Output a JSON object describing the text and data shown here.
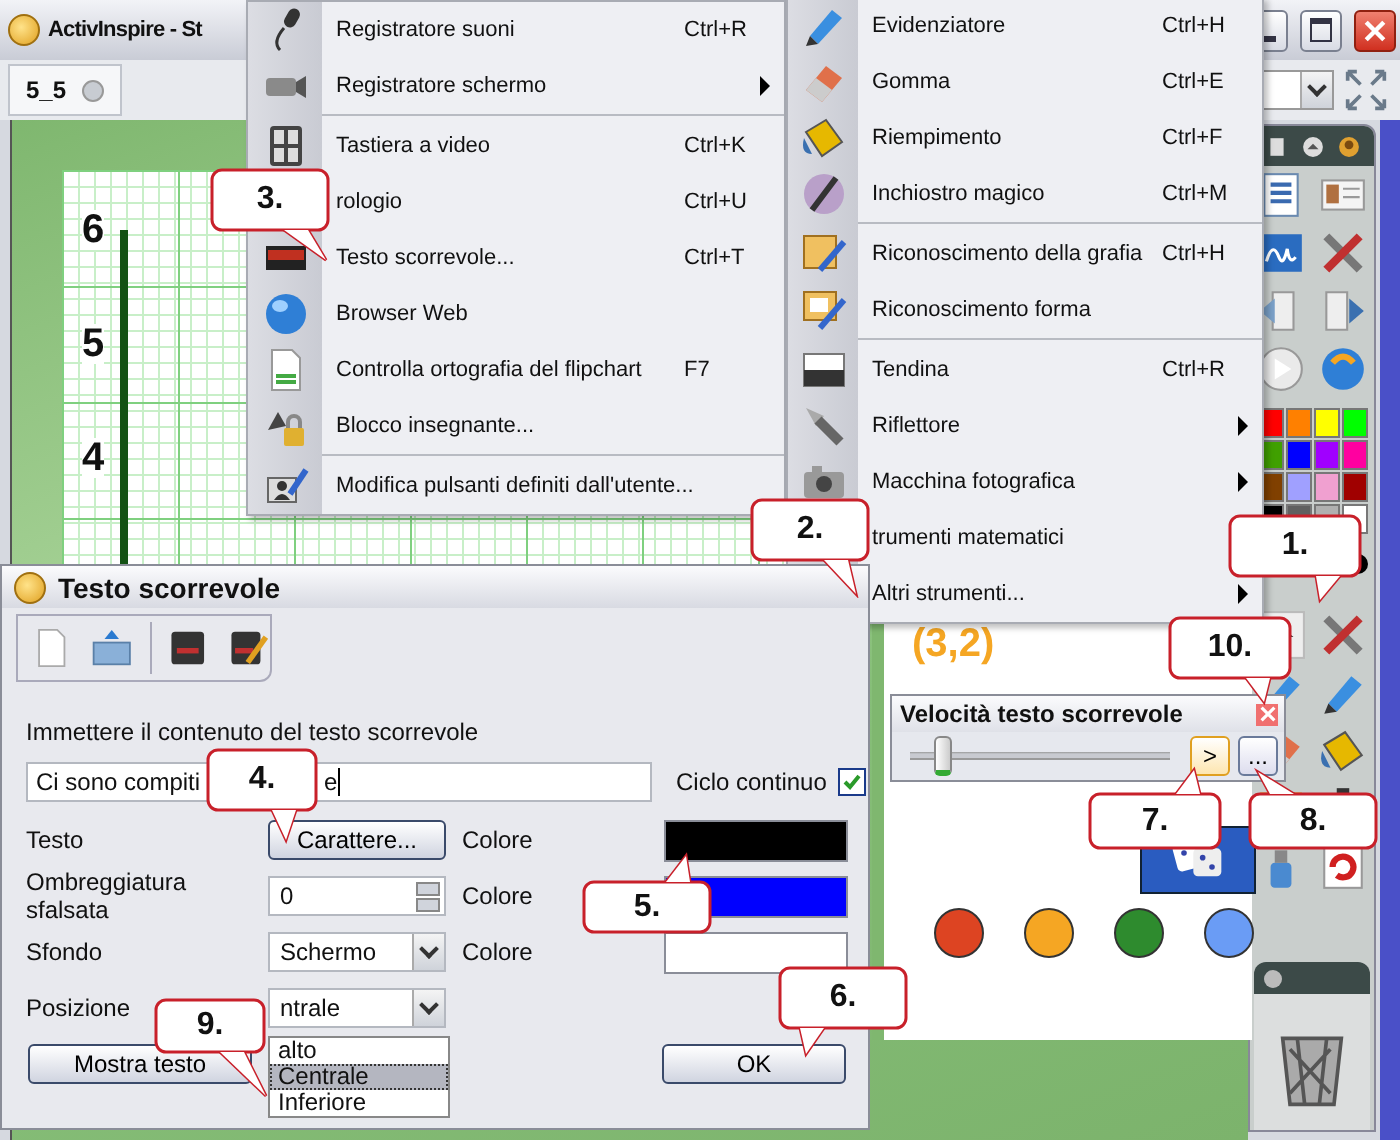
{
  "window": {
    "title": "ActivInspire - St",
    "tab": "5_5"
  },
  "tools_menu": {
    "groups": [
      [
        {
          "label": "Registratore suoni",
          "shortcut": "Ctrl+R",
          "submenu": false
        },
        {
          "label": "Registratore schermo",
          "submenu": true
        }
      ],
      [
        {
          "label": "Tastiera a video",
          "shortcut": "Ctrl+K",
          "submenu": false
        },
        {
          "label": "rologio",
          "shortcut": "Ctrl+U",
          "submenu": false
        },
        {
          "label": "Testo scorrevole...",
          "shortcut": "Ctrl+T",
          "submenu": false
        },
        {
          "label": "Browser Web",
          "submenu": false
        },
        {
          "label": "Controlla ortografia del flipchart",
          "shortcut": "F7",
          "submenu": false
        },
        {
          "label": "Blocco insegnante...",
          "submenu": false
        }
      ],
      [
        {
          "label": "Modifica pulsanti definiti dall'utente...",
          "submenu": false
        }
      ]
    ]
  },
  "more_tools_menu": {
    "groups": [
      [
        {
          "label": "Evidenziatore",
          "shortcut": "Ctrl+H",
          "submenu": false
        },
        {
          "label": "Gomma",
          "shortcut": "Ctrl+E",
          "submenu": false
        },
        {
          "label": "Riempimento",
          "shortcut": "Ctrl+F",
          "submenu": false
        },
        {
          "label": "Inchiostro magico",
          "shortcut": "Ctrl+M",
          "submenu": false
        }
      ],
      [
        {
          "label": "Riconoscimento della grafia",
          "shortcut": "Ctrl+H",
          "submenu": false
        },
        {
          "label": "Riconoscimento forma",
          "submenu": false
        }
      ],
      [
        {
          "label": "Tendina",
          "shortcut": "Ctrl+R",
          "submenu": false
        },
        {
          "label": "Riflettore",
          "submenu": true
        },
        {
          "label": "Macchina fotografica",
          "submenu": true
        },
        {
          "label": "trumenti matematici",
          "submenu": false
        },
        {
          "label": "Altri strumenti...",
          "submenu": true
        }
      ]
    ]
  },
  "flipchart": {
    "axis_labels": [
      "6",
      "5",
      "4"
    ],
    "coordinate_label": "(3,2)",
    "circles": [
      {
        "color": "#dd4422"
      },
      {
        "color": "#f5a623"
      },
      {
        "color": "#2e8b2e"
      },
      {
        "color": "#6a9cf5"
      }
    ]
  },
  "palette": [
    {
      "color": "#ff0000"
    },
    {
      "color": "#ff8000"
    },
    {
      "color": "#ffff00"
    },
    {
      "color": "#00ff00"
    },
    {
      "color": "#40a000"
    },
    {
      "color": "#0000ff"
    },
    {
      "color": "#a000ff"
    },
    {
      "color": "#ff00a0"
    },
    {
      "color": "#804000"
    },
    {
      "color": "#a0a0ff"
    },
    {
      "color": "#f0a0d0"
    },
    {
      "color": "#a00000"
    },
    {
      "color": "#000000"
    },
    {
      "color": "#606060"
    },
    {
      "color": "#b0b0b0"
    },
    {
      "color": "#ffffff"
    }
  ],
  "speed_dialog": {
    "title": "Velocità testo scorrevole",
    "level": 0.12,
    "buttons": [
      ">",
      "..."
    ]
  },
  "dialog": {
    "title": "Testo scorrevole",
    "prompt": "Immettere il contenuto del testo scorrevole",
    "text_parts": [
      "Ci sono compiti",
      "e"
    ],
    "loop_label": "Ciclo continuo",
    "loop_checked": true,
    "rows": [
      {
        "label": "Testo",
        "kind": "button",
        "control": "Carattere...",
        "color_label": "Colore",
        "color": "#000000"
      },
      {
        "label": "Ombreggiatura sfalsata",
        "kind": "spin",
        "control": "0",
        "color_label": "Colore",
        "color": "#0000ff"
      },
      {
        "label": "Sfondo",
        "kind": "combo",
        "control": "Schermo",
        "color_label": "Colore",
        "color": "#ffffff"
      },
      {
        "label": "Posizione",
        "kind": "combo",
        "control": "ntrale"
      }
    ],
    "options": [
      {
        "label": "alto",
        "selected": false
      },
      {
        "label": "Centrale",
        "selected": true
      },
      {
        "label": "Inferiore",
        "selected": false
      }
    ],
    "buttons": [
      "Mostra testo",
      "OK"
    ]
  },
  "callouts": [
    "1.",
    "2.",
    "3.",
    "4.",
    "5.",
    "6.",
    "7.",
    "8.",
    "9.",
    "10."
  ]
}
